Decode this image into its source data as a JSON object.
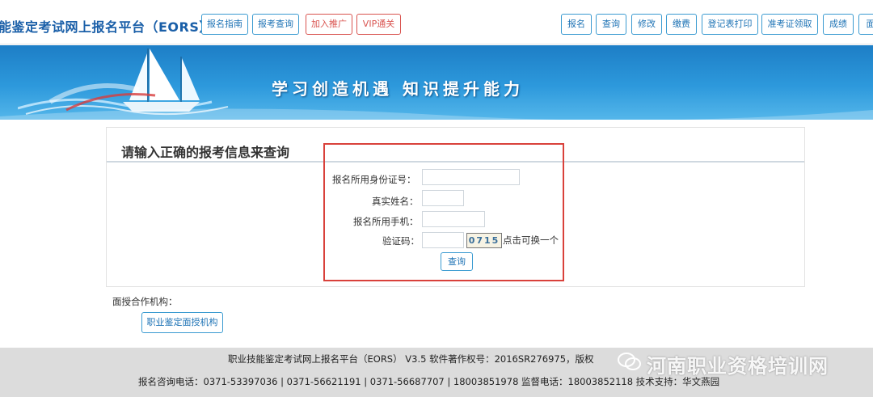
{
  "header": {
    "site_title": "能鉴定考试网上报名平台（EORS）",
    "left_nav": [
      "报名指南",
      "报考查询",
      "加入推广",
      "VIP通关"
    ],
    "right_nav": [
      "报名",
      "查询",
      "修改",
      "缴费",
      "登记表打印",
      "准考证领取",
      "成绩",
      "面"
    ]
  },
  "banner": {
    "slogan": "学习创造机遇   知识提升能力"
  },
  "query_panel": {
    "title": "请输入正确的报考信息来查询",
    "id_label": "报名所用身份证号：",
    "id_value": "",
    "name_label": "真实姓名：",
    "name_value": "",
    "phone_label": "报名所用手机：",
    "phone_value": "",
    "captcha_label": "验证码：",
    "captcha_value": "",
    "captcha_text": "0715",
    "captcha_hint": "点击可换一个",
    "submit_label": "查询"
  },
  "partners": {
    "label": "面授合作机构：",
    "button": "职业鉴定面授机构"
  },
  "footer": {
    "line1": "职业技能鉴定考试网上报名平台（EORS） V3.5 软件著作权号：2016SR276975，版权",
    "line2": "报名咨询电话：0371-53397036 | 0371-56621191 | 0371-56687707 |  18003851978  监督电话：18003852118  技术支持：华文燕园",
    "watermark": "河南职业资格培训网"
  },
  "colors": {
    "accent": "#1e73b5",
    "danger": "#d9534f",
    "banner": "#2d99dc",
    "highlight_box": "#d9413b"
  }
}
